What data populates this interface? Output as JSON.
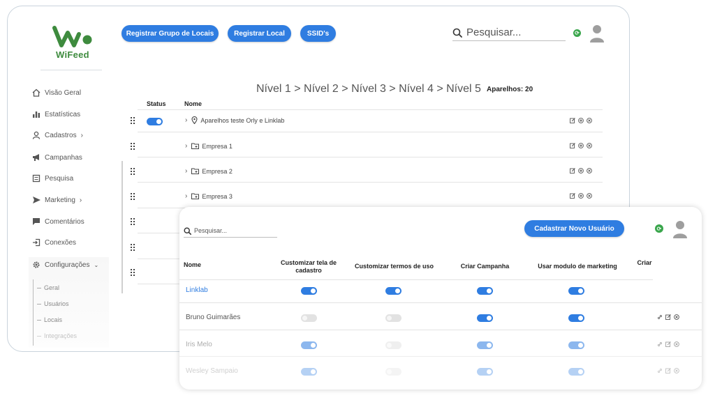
{
  "brand": {
    "name": "WiFeed",
    "color": "#3e8b3e"
  },
  "colors": {
    "accent": "#2f7de1",
    "online": "#3aa64c",
    "toggle_off": "#e2e2e2"
  },
  "header": {
    "buttons": [
      {
        "label": "Registrar Grupo de Locais"
      },
      {
        "label": "Registrar Local"
      },
      {
        "label": "SSID's"
      }
    ],
    "search_placeholder": "Pesquisar..."
  },
  "sidebar": {
    "items": [
      {
        "label": "Visão Geral",
        "icon": "home-icon"
      },
      {
        "label": "Estatísticas",
        "icon": "bar-chart-icon"
      },
      {
        "label": "Cadastros",
        "icon": "user-icon"
      },
      {
        "label": "Campanhas",
        "icon": "megaphone-icon"
      },
      {
        "label": "Pesquisa",
        "icon": "survey-icon"
      },
      {
        "label": "Marketing",
        "icon": "send-icon"
      },
      {
        "label": "Comentários",
        "icon": "comment-icon"
      },
      {
        "label": "Conexões",
        "icon": "login-icon"
      },
      {
        "label": "Configurações",
        "icon": "gear-icon"
      }
    ],
    "sub_items": [
      {
        "label": "Geral"
      },
      {
        "label": "Usuários"
      },
      {
        "label": "Locais"
      },
      {
        "label": "Integrações"
      }
    ]
  },
  "locations": {
    "breadcrumb": "Nível 1 > Nível 2 > Nível 3 > Nível 4 > Nível 5",
    "devices_label": "Aparelhos: 20",
    "columns": {
      "status": "Status",
      "name": "Nome"
    },
    "rows": [
      {
        "name": "Aparelhos teste Orly e Linklab",
        "type": "pin-icon",
        "status": true
      },
      {
        "name": "Empresa 1",
        "type": "folder-icon"
      },
      {
        "name": "Empresa 2",
        "type": "folder-icon"
      },
      {
        "name": "Empresa 3",
        "type": "folder-icon"
      }
    ]
  },
  "users": {
    "search_placeholder": "Pesquisar...",
    "add_button": "Cadastrar Novo Usuário",
    "columns": {
      "name": "Nome",
      "customize_screen": "Customizar tela de cadastro",
      "customize_terms": "Customizar termos de uso",
      "create_campaign": "Criar Campanha",
      "marketing_module": "Usar modulo de marketing",
      "create_partial": "Criar"
    },
    "rows": [
      {
        "name": "Linklab",
        "perms": [
          true,
          true,
          true,
          true
        ]
      },
      {
        "name": "Bruno Guimarães",
        "perms": [
          false,
          false,
          true,
          true
        ]
      },
      {
        "name": "Iris Melo",
        "perms": [
          true,
          false,
          true,
          true
        ]
      },
      {
        "name": "Wesley Sampaio",
        "perms": [
          true,
          false,
          true,
          true
        ]
      }
    ]
  }
}
